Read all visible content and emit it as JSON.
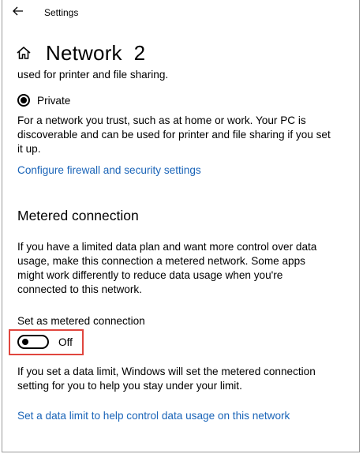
{
  "window": {
    "title": "Settings",
    "back_icon": "arrow-left-icon"
  },
  "header": {
    "home_icon": "home-icon",
    "title": "Network  2"
  },
  "profile": {
    "prev_text_tail": "used for printer and file sharing.",
    "private_label": "Private",
    "private_selected": true,
    "private_desc": "For a network you trust, such as at home or work. Your PC is discoverable and can be used for printer and file sharing if you set it up.",
    "firewall_link": "Configure firewall and security settings"
  },
  "metered": {
    "section_title": "Metered connection",
    "description": "If you have a limited data plan and want more control over data usage, make this connection a metered network. Some apps might work differently to reduce data usage when you're connected to this network.",
    "toggle_label": "Set as metered connection",
    "toggle_on": false,
    "toggle_state_text": "Off",
    "highlight_color": "#e0463e",
    "limit_info": "If you set a data limit, Windows will set the metered connection setting for you to help you stay under your limit.",
    "data_limit_link": "Set a data limit to help control data usage on this network"
  },
  "colors": {
    "link": "#1a64b8",
    "text": "#000000",
    "background": "#ffffff"
  }
}
